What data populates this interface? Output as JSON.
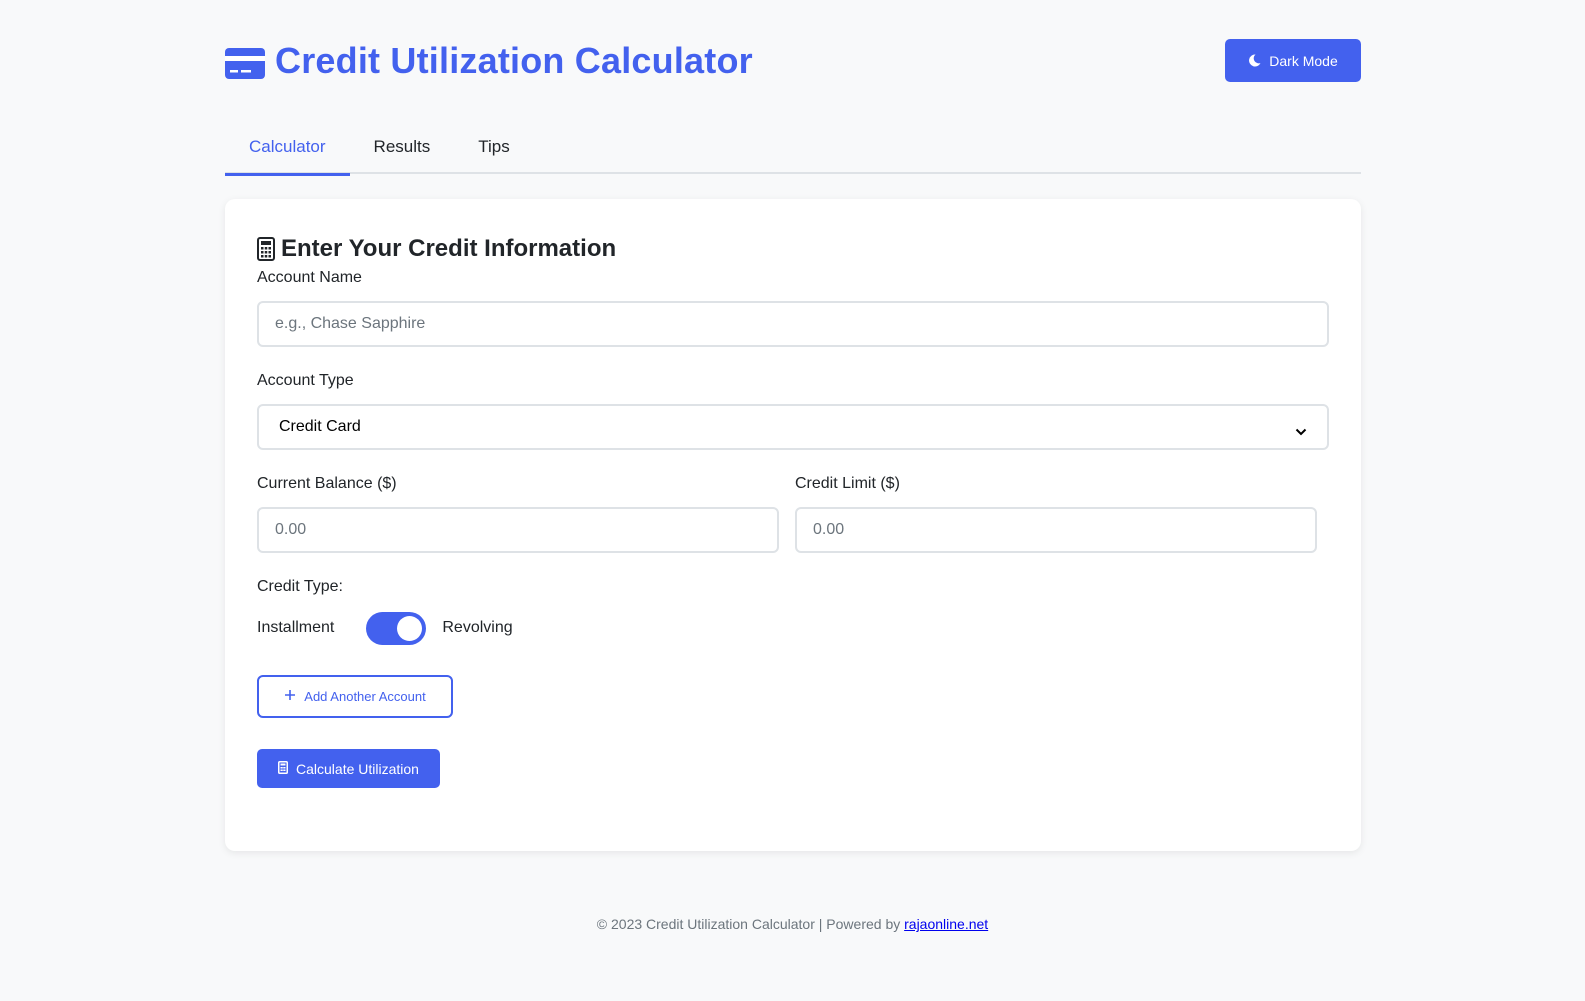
{
  "header": {
    "title": "Credit Utilization Calculator",
    "title_icon": "credit-card-icon",
    "dark_mode_label": "Dark Mode",
    "dark_mode_icon": "moon-icon"
  },
  "tabs": [
    {
      "label": "Calculator",
      "active": true
    },
    {
      "label": "Results",
      "active": false
    },
    {
      "label": "Tips",
      "active": false
    }
  ],
  "form": {
    "section_title": "Enter Your Credit Information",
    "section_icon": "calculator-icon",
    "account_name": {
      "label": "Account Name",
      "placeholder": "e.g., Chase Sapphire",
      "value": ""
    },
    "account_type": {
      "label": "Account Type",
      "selected": "Credit Card"
    },
    "current_balance": {
      "label": "Current Balance ($)",
      "placeholder": "0.00",
      "value": ""
    },
    "credit_limit": {
      "label": "Credit Limit ($)",
      "placeholder": "0.00",
      "value": ""
    },
    "credit_type": {
      "label": "Credit Type:",
      "left_option": "Installment",
      "right_option": "Revolving",
      "selected": "Revolving"
    },
    "add_account_label": "Add Another Account",
    "calculate_label": "Calculate Utilization"
  },
  "footer": {
    "text": "© 2023 Credit Utilization Calculator | Powered by ",
    "link_text": "rajaonline.net"
  },
  "colors": {
    "accent": "#4361ee",
    "background": "#f8f9fa",
    "card": "#ffffff",
    "border": "#dee2e6"
  }
}
